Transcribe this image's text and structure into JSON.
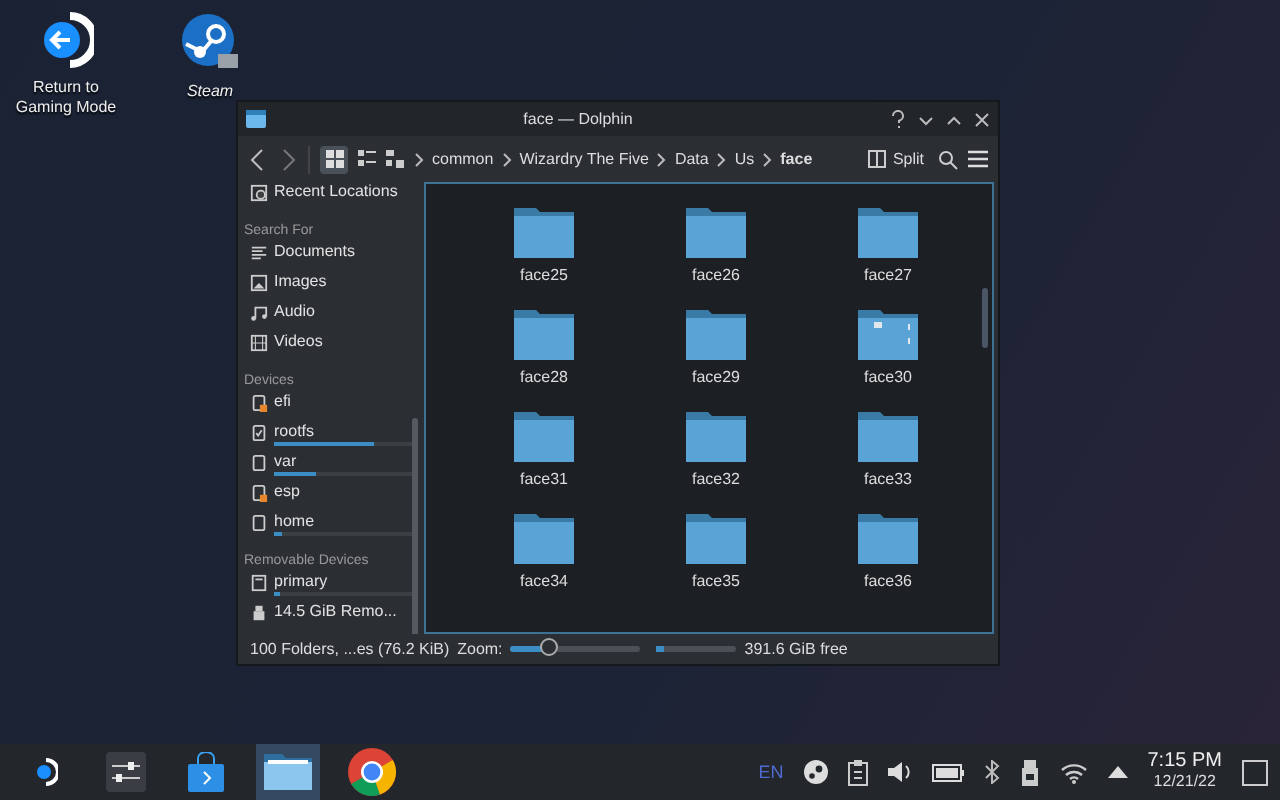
{
  "desktop_icons": [
    {
      "kind": "return",
      "label": "Return to Gaming Mode"
    },
    {
      "kind": "steam",
      "label": "Steam"
    }
  ],
  "window": {
    "title": "face — Dolphin",
    "toolbar": {
      "breadcrumbs": [
        {
          "label": "common",
          "current": false
        },
        {
          "label": "Wizardry The Five",
          "current": false
        },
        {
          "label": "Data",
          "current": false
        },
        {
          "label": "Us",
          "current": false
        },
        {
          "label": "face",
          "current": true
        }
      ],
      "split_label": "Split"
    },
    "sidebar": {
      "sections": [
        {
          "items": [
            {
              "kind": "recent",
              "label": "Recent Locations"
            }
          ]
        },
        {
          "heading": "Search For",
          "items": [
            {
              "kind": "documents",
              "label": "Documents"
            },
            {
              "kind": "images",
              "label": "Images"
            },
            {
              "kind": "audio",
              "label": "Audio"
            },
            {
              "kind": "videos",
              "label": "Videos"
            }
          ]
        },
        {
          "heading": "Devices",
          "items": [
            {
              "kind": "drive",
              "label": "efi",
              "mounted": false
            },
            {
              "kind": "drive-root",
              "label": "rootfs",
              "mounted": true,
              "level": 0.72
            },
            {
              "kind": "drive",
              "label": "var",
              "mounted": true,
              "level": 0.3
            },
            {
              "kind": "drive",
              "label": "esp",
              "mounted": false
            },
            {
              "kind": "drive",
              "label": "home",
              "mounted": true,
              "level": 0.06
            }
          ]
        },
        {
          "heading": "Removable Devices",
          "items": [
            {
              "kind": "removable",
              "label": "primary",
              "mounted": true,
              "level": 0.04
            },
            {
              "kind": "removable-drive",
              "label": "14.5 GiB Remo..."
            }
          ]
        }
      ]
    },
    "folders": [
      {
        "name": "face25",
        "kind": "folder"
      },
      {
        "name": "face26",
        "kind": "folder"
      },
      {
        "name": "face27",
        "kind": "folder"
      },
      {
        "name": "face28",
        "kind": "folder"
      },
      {
        "name": "face29",
        "kind": "folder"
      },
      {
        "name": "face30",
        "kind": "preview"
      },
      {
        "name": "face31",
        "kind": "folder"
      },
      {
        "name": "face32",
        "kind": "folder"
      },
      {
        "name": "face33",
        "kind": "folder"
      },
      {
        "name": "face34",
        "kind": "folder"
      },
      {
        "name": "face35",
        "kind": "folder"
      },
      {
        "name": "face36",
        "kind": "folder"
      }
    ],
    "status_bar": {
      "summary": "100 Folders, ...es (76.2 KiB)",
      "zoom_label": "Zoom:",
      "zoom": {
        "level": 0.3
      },
      "space": {
        "level": 0.1
      },
      "free": "391.6 GiB free"
    }
  },
  "taskbar": {
    "apps": [
      {
        "kind": "launcher",
        "active": false
      },
      {
        "kind": "mixer",
        "active": false
      },
      {
        "kind": "store",
        "active": false
      },
      {
        "kind": "files",
        "active": true
      },
      {
        "kind": "browser",
        "active": false
      }
    ],
    "tray": {
      "language": "EN",
      "time": "7:15 PM",
      "date": "12/21/22"
    }
  }
}
